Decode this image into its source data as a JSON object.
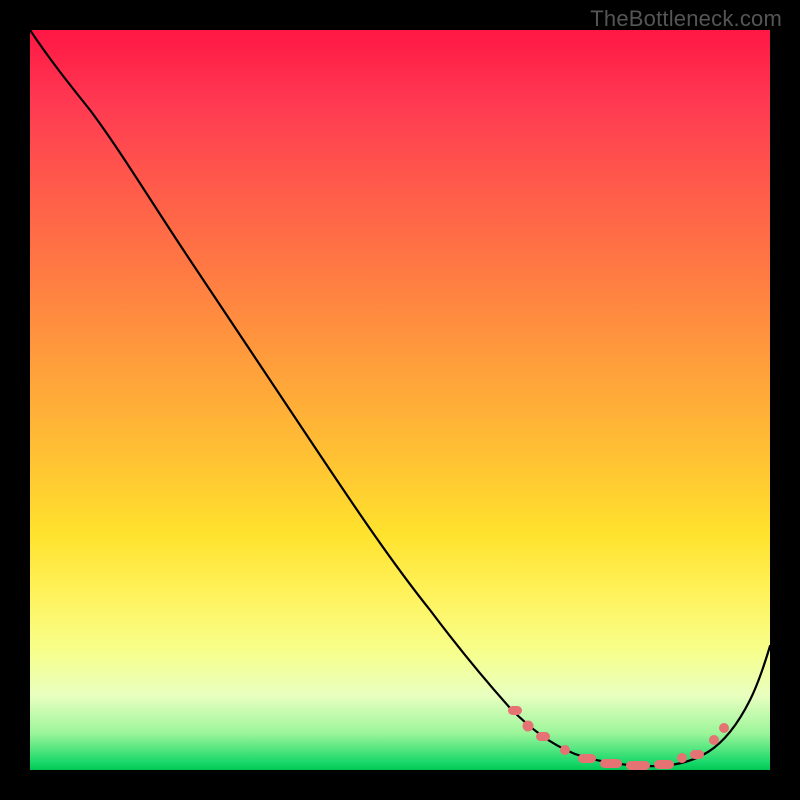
{
  "watermark": "TheBottleneck.com",
  "chart_data": {
    "type": "line",
    "title": "",
    "xlabel": "",
    "ylabel": "",
    "xlim": [
      0,
      100
    ],
    "ylim": [
      0,
      100
    ],
    "background_gradient": {
      "top": "#ff1744",
      "mid_upper": "#ff7e42",
      "mid": "#ffe22d",
      "mid_lower": "#f7ff8c",
      "bottom": "#00c853"
    },
    "series": [
      {
        "name": "bottleneck-curve",
        "x": [
          0,
          6,
          12,
          18,
          24,
          30,
          36,
          42,
          48,
          54,
          60,
          64,
          68,
          72,
          76,
          80,
          84,
          88,
          92,
          96,
          100
        ],
        "y": [
          100,
          97,
          92,
          85,
          77,
          69,
          61,
          53,
          45,
          37,
          29,
          22,
          16,
          10,
          5,
          2,
          1,
          1,
          3,
          9,
          22
        ]
      }
    ],
    "markers": {
      "name": "optimal-range-dots",
      "color": "#e57373",
      "points": [
        {
          "x": 66,
          "y": 12
        },
        {
          "x": 68,
          "y": 9
        },
        {
          "x": 70,
          "y": 6
        },
        {
          "x": 74,
          "y": 3
        },
        {
          "x": 78,
          "y": 1.5
        },
        {
          "x": 82,
          "y": 1
        },
        {
          "x": 86,
          "y": 1
        },
        {
          "x": 90,
          "y": 3
        },
        {
          "x": 93,
          "y": 6
        }
      ]
    }
  }
}
